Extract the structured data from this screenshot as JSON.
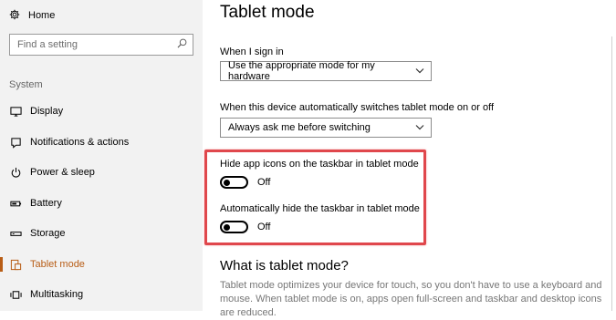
{
  "sidebar": {
    "home_label": "Home",
    "search_placeholder": "Find a setting",
    "group_label": "System",
    "items": [
      {
        "label": "Display",
        "icon": "display-icon"
      },
      {
        "label": "Notifications & actions",
        "icon": "notifications-icon"
      },
      {
        "label": "Power & sleep",
        "icon": "power-icon"
      },
      {
        "label": "Battery",
        "icon": "battery-icon"
      },
      {
        "label": "Storage",
        "icon": "storage-icon"
      },
      {
        "label": "Tablet mode",
        "icon": "tablet-mode-icon",
        "active": true
      },
      {
        "label": "Multitasking",
        "icon": "multitasking-icon"
      }
    ]
  },
  "main": {
    "title": "Tablet mode",
    "sign_in_label": "When I sign in",
    "sign_in_value": "Use the appropriate mode for my hardware",
    "switch_label": "When this device automatically switches tablet mode on or off",
    "switch_value": "Always ask me before switching",
    "hide_icons_label": "Hide app icons on the taskbar in tablet mode",
    "hide_icons_state": "Off",
    "hide_taskbar_label": "Automatically hide the taskbar in tablet mode",
    "hide_taskbar_state": "Off",
    "section_title": "What is tablet mode?",
    "description": "Tablet mode optimizes your device for touch, so you don't have to use a keyboard and mouse. When tablet mode is on, apps open full-screen and taskbar and desktop icons are reduced."
  },
  "colors": {
    "accent": "#b85d16",
    "highlight": "#e0474c",
    "sidebar_bg": "#f2f2f2"
  }
}
